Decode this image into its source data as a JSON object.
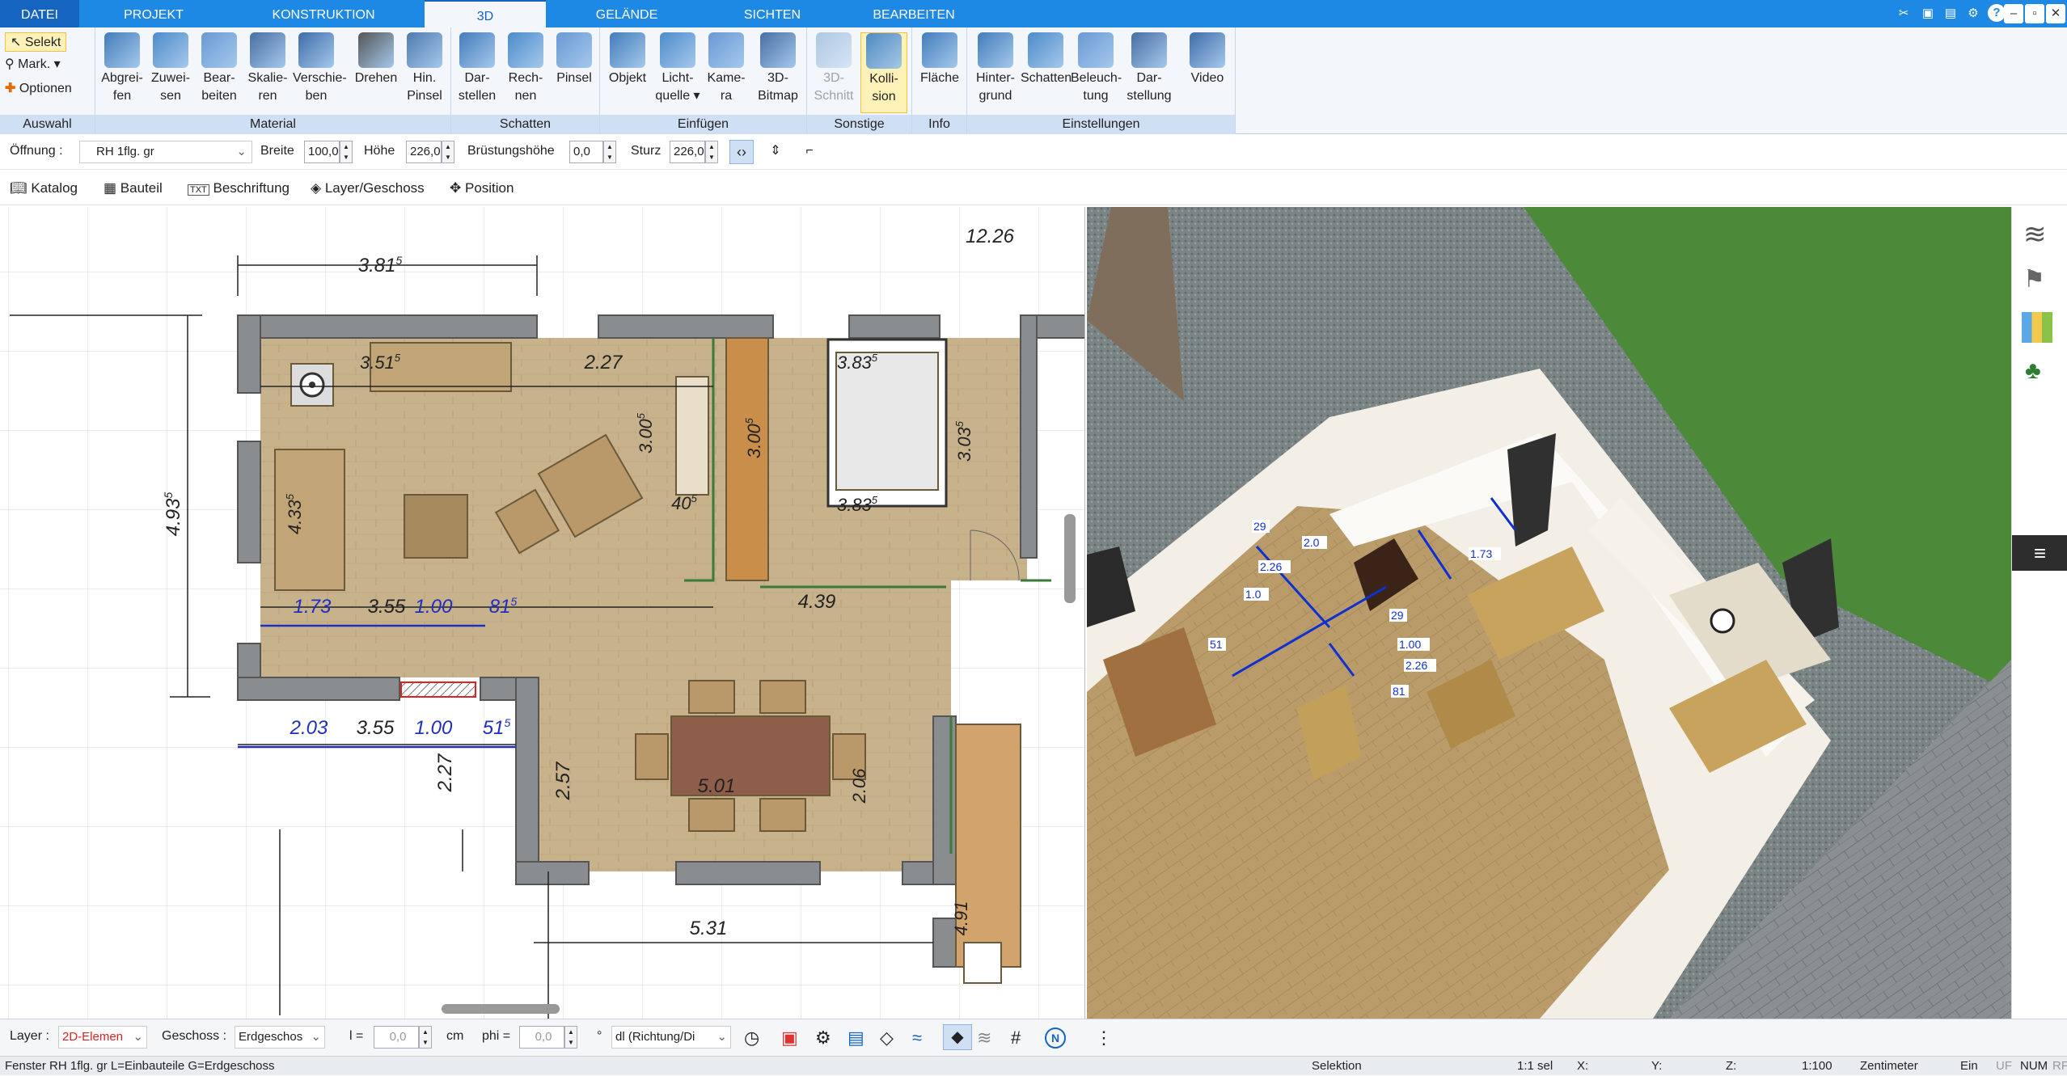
{
  "tabs": [
    {
      "label": "DATEI"
    },
    {
      "label": "PROJEKT"
    },
    {
      "label": "KONSTRUKTION"
    },
    {
      "label": "3D"
    },
    {
      "label": "GELÄNDE"
    },
    {
      "label": "SICHTEN"
    },
    {
      "label": "BEARBEITEN"
    }
  ],
  "window": {
    "help": "?",
    "min": "‒",
    "max": "▫",
    "close": "✕"
  },
  "ribbon": {
    "auswahl": {
      "label": "Auswahl",
      "selekt": "Selekt",
      "mark": "Mark.",
      "optionen": "Optionen"
    },
    "material": {
      "label": "Material",
      "buttons": [
        {
          "l1": "Abgrei-",
          "l2": "fen"
        },
        {
          "l1": "Zuwei-",
          "l2": "sen"
        },
        {
          "l1": "Bear-",
          "l2": "beiten"
        },
        {
          "l1": "Skalie-",
          "l2": "ren"
        },
        {
          "l1": "Verschie-",
          "l2": "ben"
        },
        {
          "l1": "Drehen",
          "l2": ""
        },
        {
          "l1": "Hin.",
          "l2": "Pinsel"
        }
      ]
    },
    "schatten": {
      "label": "Schatten",
      "buttons": [
        {
          "l1": "Dar-",
          "l2": "stellen"
        },
        {
          "l1": "Rech-",
          "l2": "nen"
        },
        {
          "l1": "Pinsel",
          "l2": ""
        }
      ]
    },
    "einfuegen": {
      "label": "Einfügen",
      "buttons": [
        {
          "l1": "Objekt",
          "l2": ""
        },
        {
          "l1": "Licht-",
          "l2": "quelle ▾"
        },
        {
          "l1": "Kame-",
          "l2": "ra"
        },
        {
          "l1": "3D-",
          "l2": "Bitmap"
        }
      ]
    },
    "sonstige": {
      "label": "Sonstige",
      "buttons": [
        {
          "l1": "3D-",
          "l2": "Schnitt"
        },
        {
          "l1": "Kolli-",
          "l2": "sion"
        }
      ]
    },
    "info": {
      "label": "Info",
      "buttons": [
        {
          "l1": "Fläche",
          "l2": ""
        }
      ]
    },
    "einstellungen": {
      "label": "Einstellungen",
      "buttons": [
        {
          "l1": "Hinter-",
          "l2": "grund"
        },
        {
          "l1": "Schatten",
          "l2": ""
        },
        {
          "l1": "Beleuch-",
          "l2": "tung"
        },
        {
          "l1": "Dar-",
          "l2": "stellung"
        },
        {
          "l1": "Video",
          "l2": ""
        }
      ]
    }
  },
  "propbar": {
    "oeffnung_label": "Öffnung :",
    "oeffnung_value": "RH 1flg. gr",
    "breite_label": "Breite",
    "breite_value": "100,0",
    "hoehe_label": "Höhe",
    "hoehe_value": "226,0",
    "bruestung_label": "Brüstungshöhe",
    "bruestung_value": "0,0",
    "sturz_label": "Sturz",
    "sturz_value": "226,0"
  },
  "toolbar2": {
    "katalog": "Katalog",
    "bauteil": "Bauteil",
    "beschriftung": "Beschriftung",
    "layer": "Layer/Geschoss",
    "position": "Position",
    "txt": "TXT"
  },
  "plan": {
    "dims": [
      {
        "t": "3.81",
        "s": "5"
      },
      {
        "t": "12.26",
        "s": ""
      },
      {
        "t": "3.51",
        "s": "5"
      },
      {
        "t": "2.27",
        "s": ""
      },
      {
        "t": "3.83",
        "s": "5"
      },
      {
        "t": "3.83",
        "s": "5"
      },
      {
        "t": "4.93",
        "s": "5"
      },
      {
        "t": "4.33",
        "s": "5"
      },
      {
        "t": "3.00",
        "s": "5"
      },
      {
        "t": "3.00",
        "s": "5"
      },
      {
        "t": "3.03",
        "s": "5"
      },
      {
        "t": "40",
        "s": "5"
      },
      {
        "t": "4.39",
        "s": ""
      },
      {
        "t": "2.57",
        "s": ""
      },
      {
        "t": "5.01",
        "s": ""
      },
      {
        "t": "2.06",
        "s": ""
      },
      {
        "t": "2.27",
        "s": ""
      },
      {
        "t": "5.31",
        "s": ""
      },
      {
        "t": "4.91",
        "s": ""
      },
      {
        "t": "2.03",
        "s": ""
      },
      {
        "t": "3.55",
        "s": ""
      },
      {
        "t": "1.00",
        "s": ""
      },
      {
        "t": "51",
        "s": "5"
      },
      {
        "t": "1.73",
        "s": ""
      },
      {
        "t": "3.55",
        "s": ""
      },
      {
        "t": "1.00",
        "s": ""
      },
      {
        "t": "81",
        "s": "5"
      }
    ]
  },
  "view3d": {
    "labels": [
      "29",
      "2.0",
      "2.26",
      "1.0",
      "51",
      "1.73",
      "29",
      "1.00",
      "2.26",
      "81"
    ]
  },
  "bottombar": {
    "layer_label": "Layer :",
    "layer_value": "2D-Elemen",
    "geschoss_label": "Geschoss :",
    "geschoss_value": "Erdgeschos",
    "l_label": "l =",
    "l_value": "0,0",
    "l_unit": "cm",
    "phi_label": "phi =",
    "phi_value": "0,0",
    "phi_unit": "°",
    "dl_value": "dl (Richtung/Di"
  },
  "statusbar": {
    "left": "Fenster RH 1flg. gr L=Einbauteile G=Erdgeschoss",
    "mode": "Selektion",
    "sel": "1:1 sel",
    "x": "X:",
    "y": "Y:",
    "z": "Z:",
    "scale": "1:100",
    "unit": "Zentimeter",
    "ein": "Ein",
    "uf": "UF",
    "num": "NUM",
    "rf": "RF"
  },
  "colors": {
    "accent": "#1e88e5",
    "ribbon_bg": "#f3f7fc",
    "group_label_bg": "#cfe0f5",
    "dim_blue": "#1f2fc0"
  }
}
